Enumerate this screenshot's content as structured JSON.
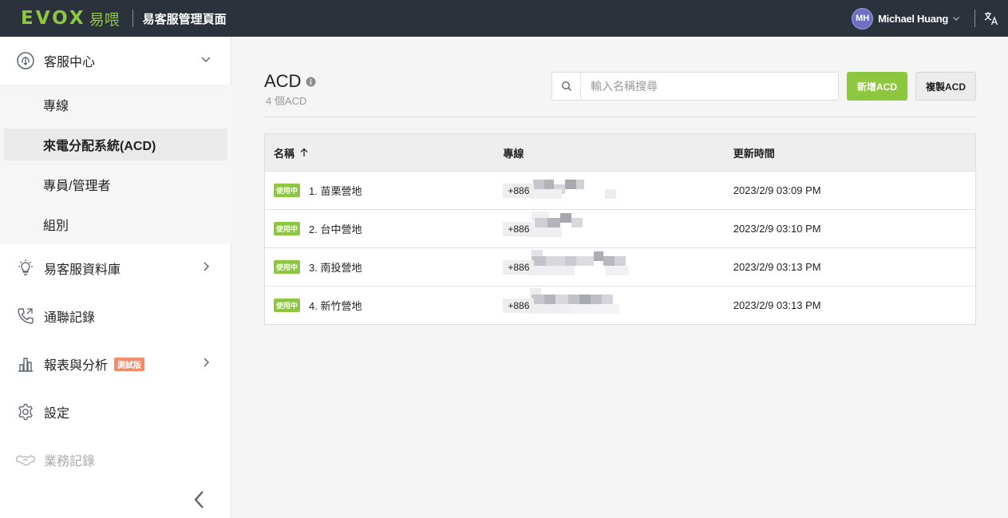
{
  "header": {
    "logo_text": "EVOX",
    "logo_cn": "易喂",
    "app_title": "易客服管理頁面",
    "user_initials": "MH",
    "user_name": "Michael Huang"
  },
  "sidebar": {
    "items": [
      {
        "label": "客服中心",
        "icon": "headset-icon",
        "expanded": true
      },
      {
        "label": "易客服資料庫",
        "icon": "lightbulb-icon"
      },
      {
        "label": "通聯記錄",
        "icon": "phone-log-icon"
      },
      {
        "label": "報表與分析",
        "icon": "bar-chart-icon",
        "badge": "測試版"
      },
      {
        "label": "設定",
        "icon": "gear-icon"
      },
      {
        "label": "業務記錄",
        "icon": "handshake-icon",
        "disabled": true
      }
    ],
    "sub_items": [
      {
        "label": "專線"
      },
      {
        "label": "來電分配系統(ACD)",
        "active": true
      },
      {
        "label": "專員/管理者"
      },
      {
        "label": "組別"
      }
    ]
  },
  "main": {
    "title": "ACD",
    "count_text": "4 個ACD",
    "search_placeholder": "輸入名稱搜尋",
    "add_button": "新增ACD",
    "copy_button": "複製ACD",
    "table": {
      "headers": [
        "名稱",
        "專線",
        "更新時間"
      ],
      "rows": [
        {
          "status": "使用中",
          "name": "1. 苗栗營地",
          "line": "+886",
          "updated": "2023/2/9 03:09 PM"
        },
        {
          "status": "使用中",
          "name": "2. 台中營地",
          "line": "+886",
          "updated": "2023/2/9 03:10 PM"
        },
        {
          "status": "使用中",
          "name": "3. 南投營地",
          "line": "+886",
          "updated": "2023/2/9 03:13 PM"
        },
        {
          "status": "使用中",
          "name": "4. 新竹營地",
          "line": "+886",
          "updated": "2023/2/9 03:13 PM"
        }
      ]
    }
  },
  "colors": {
    "topbar_bg": "#2b323b",
    "brand_green": "#8dc63f",
    "badge_orange": "#f28b6b",
    "avatar_purple": "#6e6fc0"
  }
}
